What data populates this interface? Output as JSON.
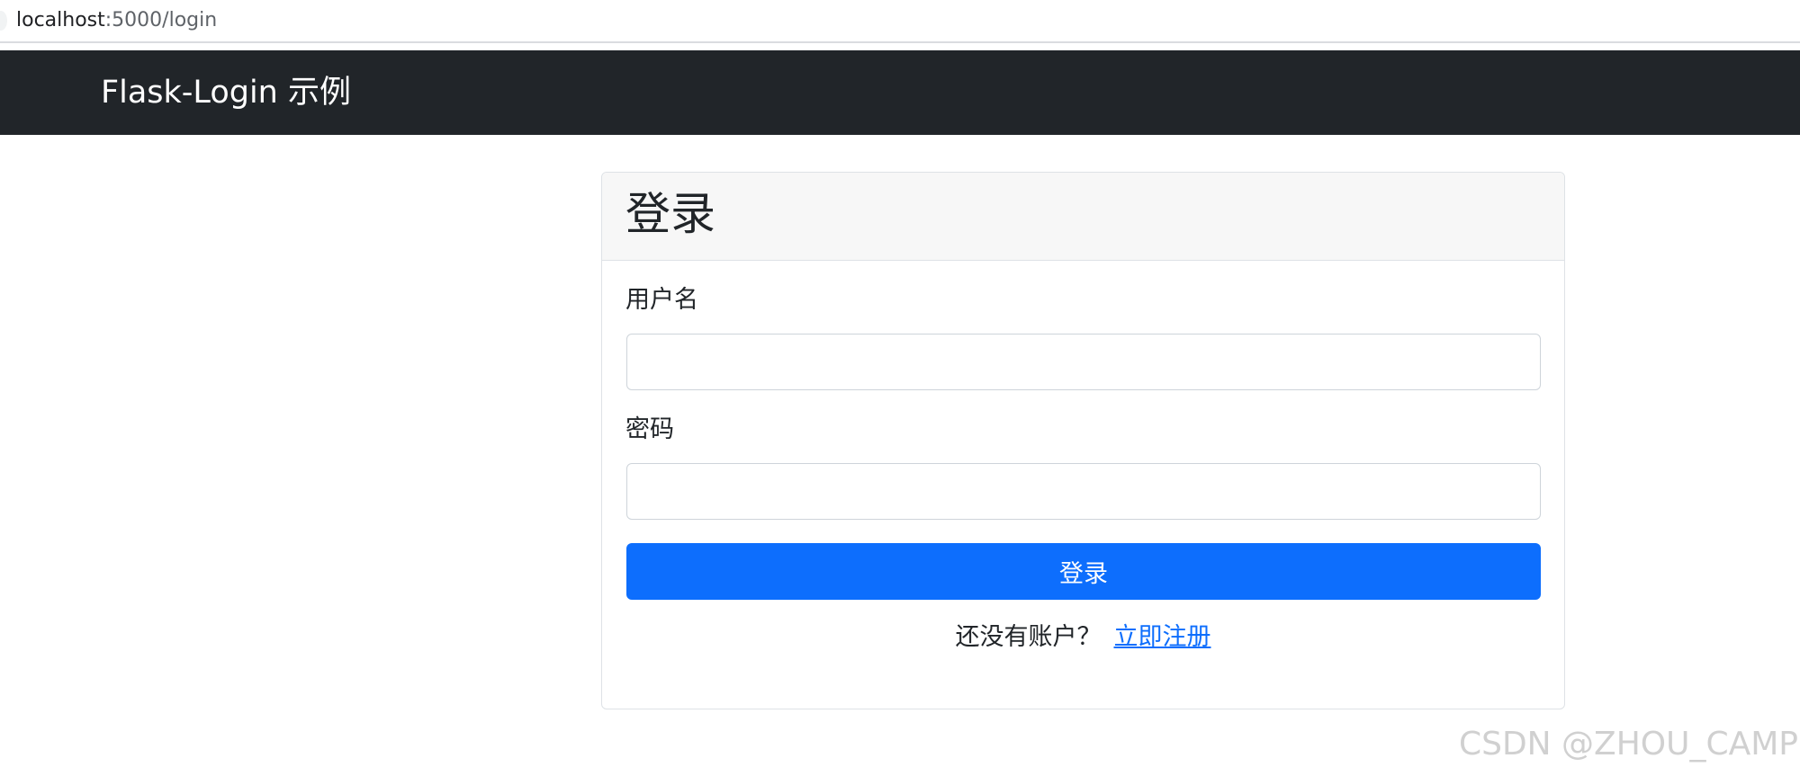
{
  "browser": {
    "url_host": "localhost",
    "url_path": ":5000/login"
  },
  "navbar": {
    "brand": "Flask-Login 示例"
  },
  "login_card": {
    "title": "登录",
    "username_label": "用户名",
    "username_value": "",
    "password_label": "密码",
    "password_value": "",
    "submit_label": "登录",
    "register_prompt": "还没有账户？",
    "register_link": "立即注册"
  },
  "watermark": "CSDN @ZHOU_CAMP",
  "colors": {
    "navbar_bg": "#212529",
    "primary": "#0d6efd",
    "card_header_bg": "#f7f7f7"
  }
}
